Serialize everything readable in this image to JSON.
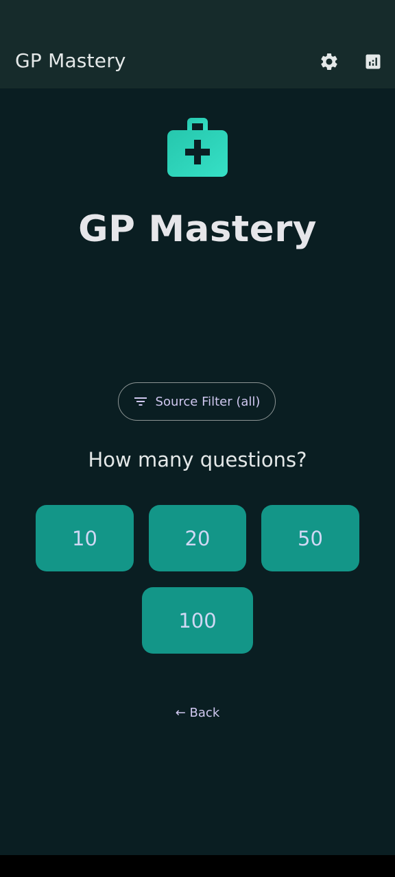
{
  "app_bar": {
    "title": "GP Mastery",
    "settings_icon": "gear-icon",
    "stats_icon": "bar-chart-icon"
  },
  "hero": {
    "icon": "medical-bag-icon",
    "title": "GP Mastery"
  },
  "filter": {
    "icon": "filter-icon",
    "label": "Source Filter (all)"
  },
  "question_heading": "How many questions?",
  "counts": [
    "10",
    "20",
    "50",
    "100"
  ],
  "back_label": "← Back",
  "colors": {
    "background": "#0a1e22",
    "app_bar": "#162b2b",
    "accent": "#2dd4bf",
    "count_button": "#139688",
    "link_text": "#d0c8f0"
  }
}
